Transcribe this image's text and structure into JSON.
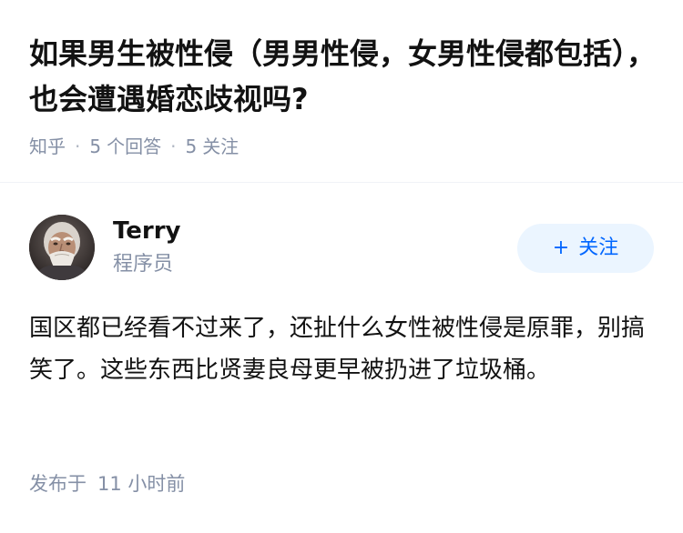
{
  "question": {
    "title": "如果男生被性侵（男男性侵，女男性侵都包括），也会遭遇婚恋歧视吗?",
    "source": "知乎",
    "answer_count": "5",
    "answer_label": "个回答",
    "follow_count": "5",
    "follow_label": "关注"
  },
  "answer": {
    "author": {
      "name": "Terry",
      "headline": "程序员"
    },
    "follow_button": {
      "plus": "+",
      "label": "关注"
    },
    "content": "国区都已经看不过来了，还扯什么女性被性侵是原罪，别搞笑了。这些东西比贤妻良母更早被扔进了垃圾桶。",
    "publish_label": "发布于",
    "publish_time": "11 小时前"
  },
  "colors": {
    "text_primary": "#121212",
    "text_secondary": "#8590a6",
    "brand_blue": "#0066ff",
    "button_bg": "#ebf5ff",
    "divider": "#f0f2f7"
  }
}
